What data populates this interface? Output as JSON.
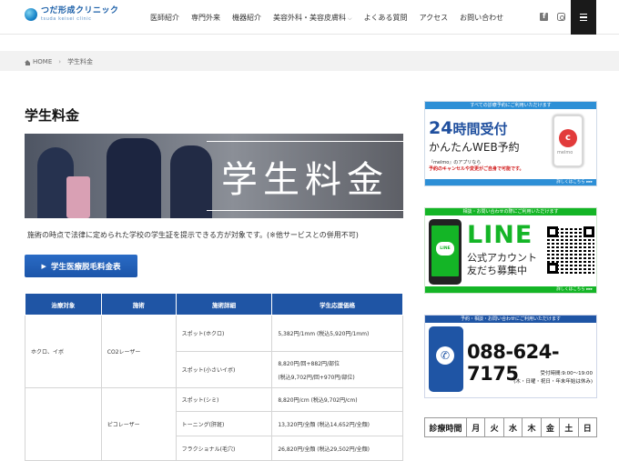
{
  "header": {
    "logo_ja": "つだ形成クリニック",
    "logo_en": "tsuda keisei clinic",
    "nav": [
      "医師紹介",
      "専門外来",
      "機器紹介",
      "美容外科・美容皮膚科",
      "よくある質問",
      "アクセス",
      "お問い合わせ"
    ]
  },
  "breadcrumb": {
    "home": "HOME",
    "current": "学生料金"
  },
  "page": {
    "title": "学生料金",
    "hero_title": "学生料金",
    "note": "施術の時点で法律に定められた学校の学生証を提示できる方が対象です。(※他サービスとの併用不可)",
    "cta": "学生医療脱毛料金表"
  },
  "table": {
    "headers": [
      "治療対象",
      "施術",
      "施術詳細",
      "学生応援価格"
    ],
    "rows": [
      {
        "target": "ホクロ、イボ",
        "method": "CO2レーザー",
        "details": [
          {
            "name": "スポット(ホクロ)",
            "price": "5,382円/1mm  (税込5,920円/1mm)"
          },
          {
            "name": "スポット(小さいイボ)",
            "price": "8,820円/回+882円/部位",
            "price2": "(税込9,702円/回+970円/部位)"
          }
        ]
      },
      {
        "target": "",
        "method": "ピコレーザー",
        "details": [
          {
            "name": "スポット(シミ)",
            "price": "8,820円/cm  (税込9,702円/cm)"
          },
          {
            "name": "トーニング(肝斑)",
            "price": "13,320円/全顔  (税込14,652円/全顔)"
          },
          {
            "name": "フラクショナル(毛穴)",
            "price": "26,820円/全顔  (税込29,502円/全顔)"
          }
        ]
      }
    ]
  },
  "sidebar": {
    "web": {
      "header": "すべての診療予約にご利用いただけます",
      "big_num": "24",
      "big_text": "時間受付",
      "sub": "かんたんWEB予約",
      "note1": "『melmo』のアプリなら",
      "note2": "予約のキャンセルや変更がご自身で可能です。",
      "app": "melmo",
      "more": "詳しくはこちら ▸▸▸"
    },
    "line": {
      "header": "相談・お問い合わせの際にご利用いただけます",
      "icon_label": "LINE",
      "big": "LINE",
      "sub1": "公式アカウント",
      "sub2": "友だち募集中",
      "more": "詳しくはこちら ▸▸▸"
    },
    "tel": {
      "header": "予約・相談・お問い合わせにご利用いただけます",
      "number": "088-624-7175",
      "hours1": "受付時間:9:00〜19:00",
      "hours2": "(木・日曜・祝日・年末年始は休み)"
    },
    "hours_table": [
      "診療時間",
      "月",
      "火",
      "水",
      "木",
      "金",
      "土",
      "日"
    ]
  }
}
